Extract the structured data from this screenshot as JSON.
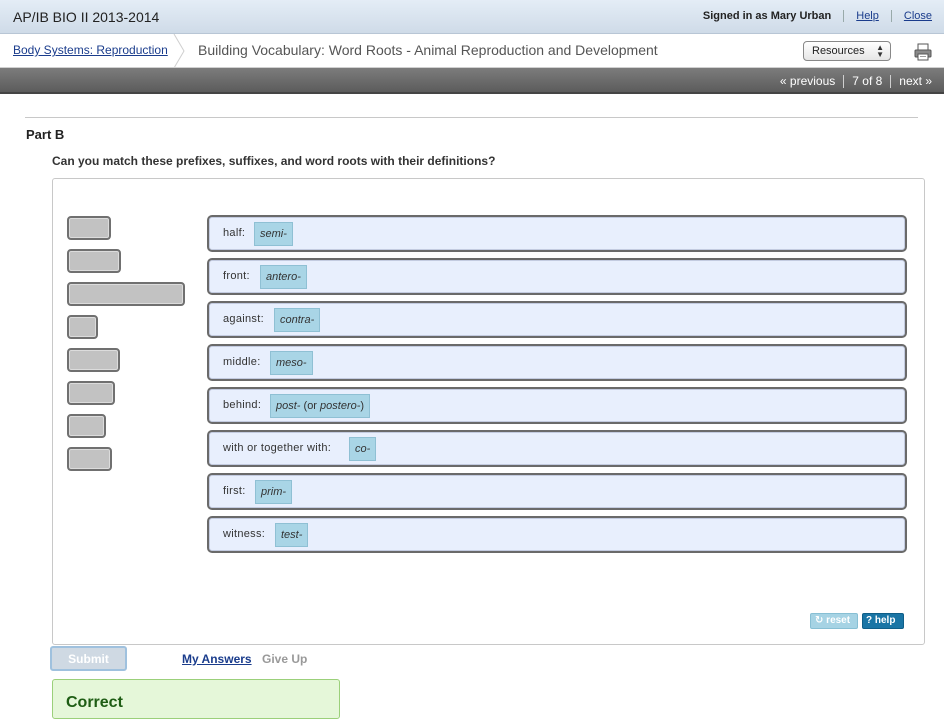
{
  "topbar": {
    "course_title": "AP/IB BIO II 2013-2014",
    "signed_in": "Signed in as Mary Urban",
    "help": "Help",
    "close": "Close"
  },
  "breadcrumb": {
    "parent": "Body Systems: Reproduction",
    "title": "Building Vocabulary: Word Roots - Animal Reproduction and Development",
    "resources_label": "Resources",
    "print_icon": "printer-icon"
  },
  "nav": {
    "previous": "« previous",
    "counter": "7 of 8",
    "next": "next »"
  },
  "part": {
    "title": "Part B",
    "question": "Can you match these prefixes, suffixes, and word roots with their definitions?"
  },
  "matches": [
    {
      "label": "half:",
      "answer": "semi-"
    },
    {
      "label": "front:",
      "answer": "antero-"
    },
    {
      "label": "against:",
      "answer": "contra-"
    },
    {
      "label": "middle:",
      "answer": "meso-"
    },
    {
      "label": "behind:",
      "answer": "post-",
      "answer_extra": " (or ",
      "answer_alt": "postero-",
      "answer_close": ")"
    },
    {
      "label": "with or together with:",
      "answer": "co-"
    },
    {
      "label": "first:",
      "answer": "prim-"
    },
    {
      "label": "witness:",
      "answer": "test-"
    }
  ],
  "controls": {
    "reset": "reset",
    "help": "help",
    "reset_icon": "refresh-icon",
    "help_icon": "question-icon"
  },
  "actions": {
    "submit": "Submit",
    "my_answers": "My Answers",
    "give_up": "Give Up"
  },
  "feedback": {
    "status": "Correct"
  },
  "colors": {
    "chip": "#a9d5e6",
    "target_bg": "#e8effd",
    "correct_bg": "#e5f7d9",
    "correct_text": "#1e5d14"
  }
}
